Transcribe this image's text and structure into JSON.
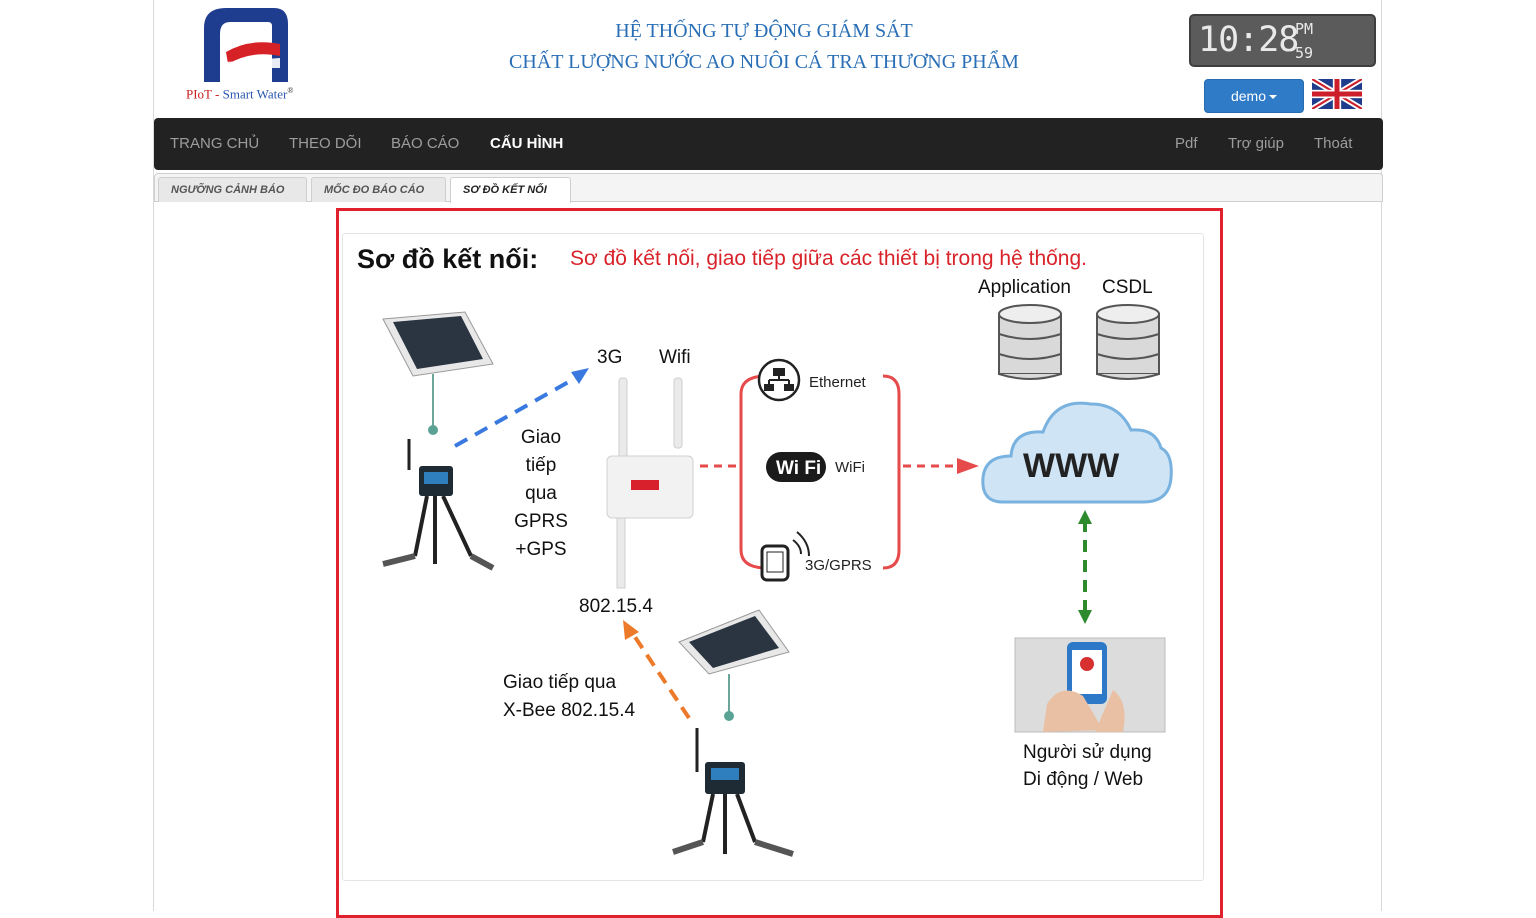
{
  "header": {
    "logo_caption_brand": "PIoT",
    "logo_caption_rest": "Smart Water",
    "logo_caption_sep": "-",
    "logo_reg": "®",
    "title_line1": "HỆ THỐNG TỰ ĐỘNG GIÁM SÁT",
    "title_line2": "CHẤT LƯỢNG NƯỚC AO NUÔI CÁ TRA THƯƠNG PHẨM",
    "clock": {
      "hour_minute": "10:28",
      "ampm": "PM",
      "seconds": "59"
    },
    "user_button": "demo",
    "language_flag": "uk-flag-icon"
  },
  "nav": {
    "left": [
      "TRANG CHỦ",
      "THEO DÕI",
      "BÁO CÁO",
      "CẤU HÌNH"
    ],
    "active": "CẤU HÌNH",
    "right": [
      "Pdf",
      "Trợ giúp",
      "Thoát"
    ]
  },
  "tabs": {
    "items": [
      "NGƯỠNG CẢNH BÁO",
      "MỐC ĐO BÁO CÁO",
      "SƠ ĐỒ KẾT NỐI"
    ],
    "active": "SƠ ĐỒ KẾT NỐI"
  },
  "diagram": {
    "title": "Sơ đồ kết nối:",
    "subtitle": "Sơ đồ kết nối, giao tiếp giữa các thiết bị trong hệ thống.",
    "label_application": "Application",
    "label_csdl": "CSDL",
    "label_3g": "3G",
    "label_wifi": "Wifi",
    "label_gprs": "Giao tiếp qua GPRS +GPS",
    "label_gprs_lines": [
      "Giao",
      "tiếp",
      "qua",
      "GPRS",
      "+GPS"
    ],
    "label_802": "802.15.4",
    "label_xbee_1": "Giao tiếp qua",
    "label_xbee_2": "X-Bee 802.15.4",
    "label_ethernet": "Ethernet",
    "label_wifi_small": "WiFi",
    "label_wifi_logo": "Wi Fi",
    "label_3ggprs": "3G/GPRS",
    "label_www": "WWW",
    "label_user_1": "Người sử dụng",
    "label_user_2": "Di động / Web",
    "colors": {
      "accent_red": "#e0202c",
      "blue_dash": "#3a7ae0",
      "orange_dash": "#ec7a2a",
      "green_dash": "#2d8a2d",
      "cloud": "#cfe4f5"
    }
  }
}
